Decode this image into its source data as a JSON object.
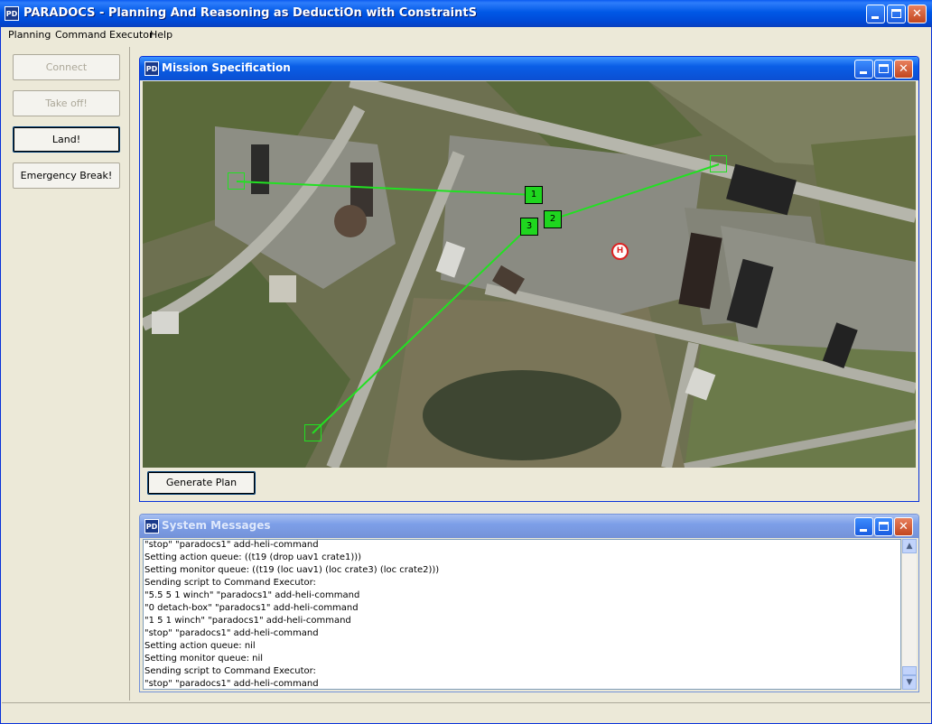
{
  "app": {
    "title": "PARADOCS - Planning And Reasoning as DeductiOn with ConstraintS",
    "icon_label": "PD"
  },
  "menu": [
    {
      "label": "Planning"
    },
    {
      "label": "Command Executor"
    },
    {
      "label": "Help"
    }
  ],
  "left_buttons": {
    "connect": "Connect",
    "take_off": "Take off!",
    "land": "Land!",
    "emergency_break": "Emergency Break!"
  },
  "mission": {
    "title": "Mission Specification",
    "generate_plan": "Generate Plan",
    "waypoints": [
      {
        "label": "1"
      },
      {
        "label": "2"
      },
      {
        "label": "3"
      }
    ],
    "heliport_label": "H"
  },
  "messages": {
    "title": "System Messages",
    "lines": [
      "\"stop\" \"paradocs1\" add-heli-command",
      "Setting action queue: ((t19 (drop uav1 crate1)))",
      "Setting monitor queue: ((t19 (loc uav1) (loc crate3) (loc crate2)))",
      "Sending script to Command Executor:",
      "\"5.5 5 1 winch\" \"paradocs1\" add-heli-command",
      "\"0 detach-box\" \"paradocs1\" add-heli-command",
      "\"1 5 1 winch\" \"paradocs1\" add-heli-command",
      "\"stop\" \"paradocs1\" add-heli-command",
      "Setting action queue: nil",
      "Setting monitor queue: nil",
      "Sending script to Command Executor:",
      "\"stop\" \"paradocs1\" add-heli-command"
    ]
  },
  "colors": {
    "route": "#22e022",
    "waypoint_fill": "#1fd61f",
    "title_active": "#0a5ee6",
    "title_inactive": "#7d9fe8"
  }
}
